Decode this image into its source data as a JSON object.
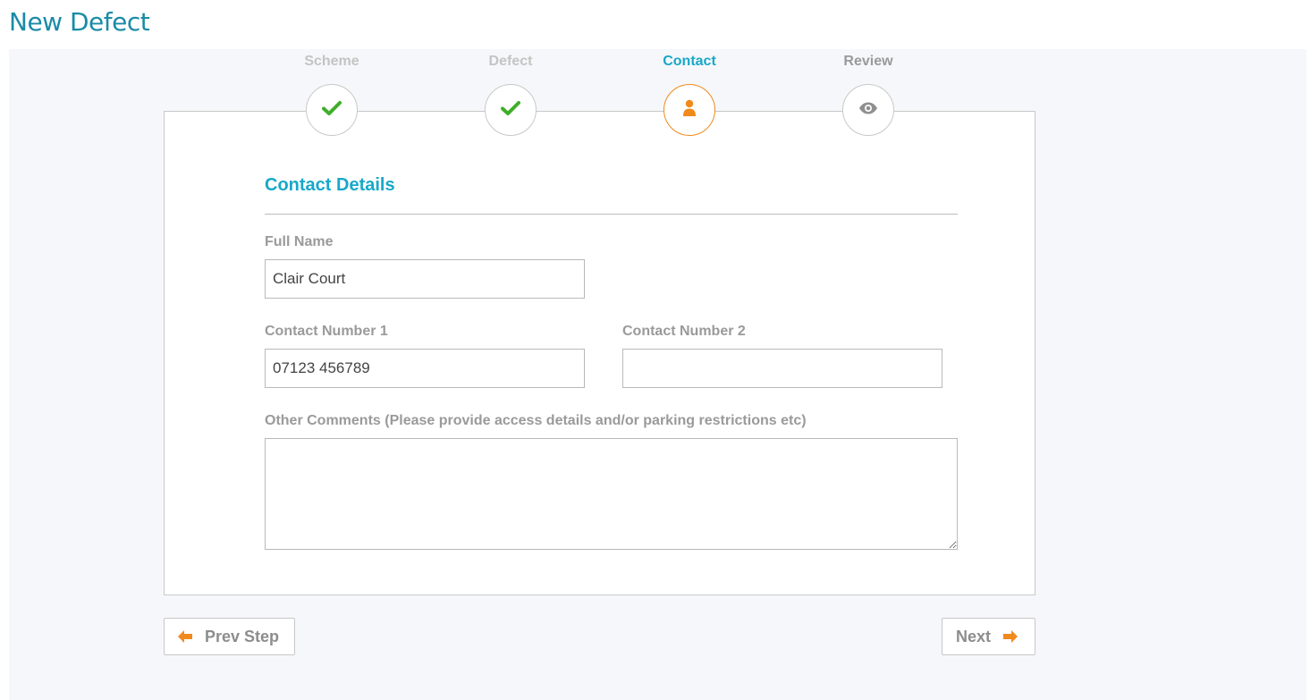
{
  "page": {
    "title": "New Defect"
  },
  "wizard": {
    "steps": [
      {
        "label": "Scheme",
        "state": "done",
        "icon": "check-icon"
      },
      {
        "label": "Defect",
        "state": "done",
        "icon": "check-icon"
      },
      {
        "label": "Contact",
        "state": "active",
        "icon": "user-icon"
      },
      {
        "label": "Review",
        "state": "pending",
        "icon": "eye-icon"
      }
    ]
  },
  "form": {
    "section_title": "Contact Details",
    "full_name": {
      "label": "Full Name",
      "value": "Clair Court"
    },
    "contact_number_1": {
      "label": "Contact Number 1",
      "value": "07123 456789"
    },
    "contact_number_2": {
      "label": "Contact Number 2",
      "value": ""
    },
    "comments": {
      "label": "Other Comments (Please provide access details and/or parking restrictions etc)",
      "value": ""
    }
  },
  "nav": {
    "prev_label": "Prev Step",
    "next_label": "Next"
  },
  "colors": {
    "title": "#1a8ba6",
    "accent": "#18a8c9",
    "active_step": "#f08a1c",
    "check": "#3fae2a",
    "arrow": "#f08a1c"
  }
}
